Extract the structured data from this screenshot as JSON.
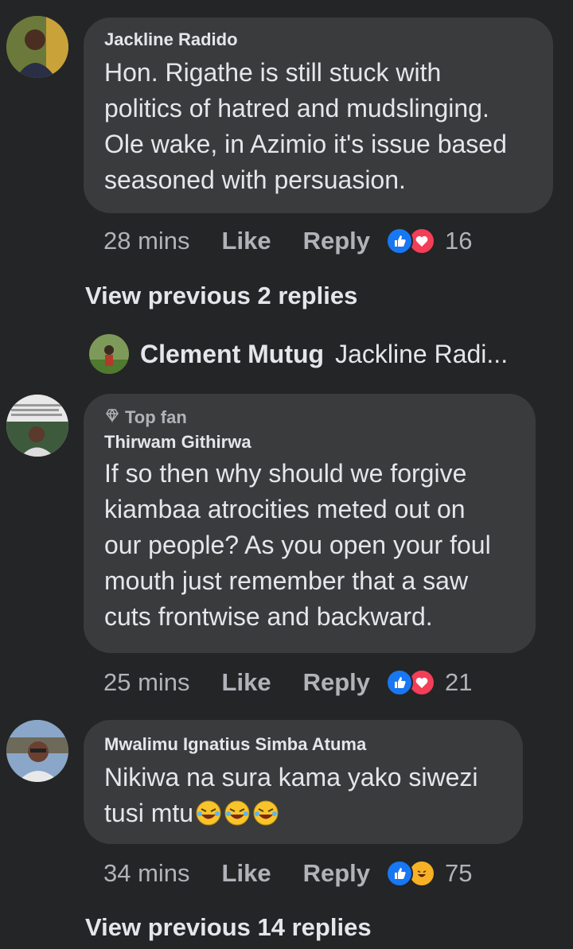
{
  "comments": [
    {
      "author": "Jackline Radido",
      "top_fan_label": "",
      "text": "Hon. Rigathe is still stuck with politics of hatred and mudslinging. Ole wake, in Azimio it's issue based seasoned with persuasion.",
      "lines": [
        "Hon. Rigathe is still stuck with",
        "politics of hatred and mudslinging.",
        "Ole wake, in Azimio it's issue based",
        "seasoned with persuasion."
      ],
      "time": "28 mins",
      "like_label": "Like",
      "reply_label": "Reply",
      "reaction_icons": [
        "like-icon",
        "love-icon"
      ],
      "reaction_count": "16"
    },
    {
      "author": "Thirwam Githirwa",
      "top_fan_label": "Top fan",
      "lines": [
        "If  so then why should we forgive",
        "kiambaa atrocities meted out on",
        "our people? As you open your foul",
        "mouth just remember that a saw",
        "cuts frontwise and backward."
      ],
      "time": "25 mins",
      "like_label": "Like",
      "reply_label": "Reply",
      "reaction_icons": [
        "like-icon",
        "love-icon"
      ],
      "reaction_count": "21"
    },
    {
      "author": "Mwalimu Ignatius Simba Atuma",
      "lines": [
        "Nikiwa na sura kama yako siwezi",
        "tusi mtu"
      ],
      "emoji_icons": [
        "rofl-emoji-icon",
        "rofl-emoji-icon",
        "rofl-emoji-icon"
      ],
      "time": "34 mins",
      "like_label": "Like",
      "reply_label": "Reply",
      "reaction_icons": [
        "like-icon",
        "haha-icon"
      ],
      "reaction_count": "75"
    }
  ],
  "view_previous_1": "View previous 2 replies",
  "collapsed_reply": {
    "author": "Clement Mutug",
    "preview": "Jackline Radi..."
  },
  "view_previous_2": "View previous 14 replies",
  "colors": {
    "background": "#242526",
    "bubble": "#3a3b3c",
    "like": "#1877f2",
    "love": "#f33e58",
    "haha": "#f7b125"
  }
}
